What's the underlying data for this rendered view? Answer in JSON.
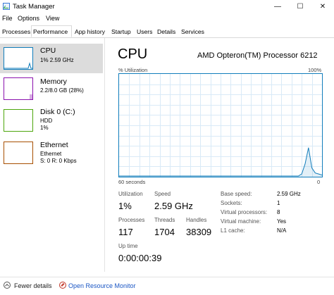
{
  "window": {
    "title": "Task Manager",
    "minimize_glyph": "—",
    "maximize_glyph": "☐",
    "close_glyph": "✕"
  },
  "menu": [
    "File",
    "Options",
    "View"
  ],
  "tabs": [
    "Processes",
    "Performance",
    "App history",
    "Startup",
    "Users",
    "Details",
    "Services"
  ],
  "active_tab": "Performance",
  "sidebar": {
    "items": [
      {
        "title": "CPU",
        "line1": "1% 2.59 GHz",
        "line2": "",
        "color": "#117dbb"
      },
      {
        "title": "Memory",
        "line1": "2.2/8.0 GB (28%)",
        "line2": "",
        "color": "#8b12ae"
      },
      {
        "title": "Disk 0 (C:)",
        "line1": "HDD",
        "line2": "1%",
        "color": "#4da60c"
      },
      {
        "title": "Ethernet",
        "line1": "Ethernet",
        "line2": "S: 0 R: 0 Kbps",
        "color": "#a74f01"
      }
    ]
  },
  "main": {
    "title": "CPU",
    "processor": "AMD Opteron(TM) Processor 6212",
    "graph": {
      "y_label": "% Utilization",
      "y_max_label": "100%",
      "x_label": "60 seconds",
      "x_min_label": "0",
      "line_color": "#117dbb",
      "grid_color": "#d9eaf7",
      "points": [
        0,
        0,
        0,
        0,
        0,
        0,
        0,
        0,
        0,
        0,
        0,
        0,
        0,
        0,
        0,
        0,
        0,
        0,
        0,
        0,
        0,
        0,
        0,
        0,
        0,
        0,
        0,
        0,
        0,
        0,
        0,
        0,
        0,
        0,
        0,
        0,
        0,
        0,
        0,
        0,
        0,
        0,
        0,
        0,
        0,
        0,
        0,
        0,
        0,
        0,
        0,
        0,
        0,
        0,
        2,
        12,
        28,
        8,
        3,
        2,
        1
      ]
    },
    "stats": {
      "utilization_label": "Utilization",
      "utilization_value": "1%",
      "speed_label": "Speed",
      "speed_value": "2.59 GHz",
      "processes_label": "Processes",
      "processes_value": "117",
      "threads_label": "Threads",
      "threads_value": "1704",
      "handles_label": "Handles",
      "handles_value": "38309",
      "uptime_label": "Up time",
      "uptime_value": "0:00:00:39"
    },
    "details": [
      {
        "label": "Base speed:",
        "value": "2.59 GHz"
      },
      {
        "label": "Sockets:",
        "value": "1"
      },
      {
        "label": "Virtual processors:",
        "value": "8"
      },
      {
        "label": "Virtual machine:",
        "value": "Yes"
      },
      {
        "label": "L1 cache:",
        "value": "N/A"
      }
    ]
  },
  "footer": {
    "fewer_details": "Fewer details",
    "open_monitor": "Open Resource Monitor"
  }
}
